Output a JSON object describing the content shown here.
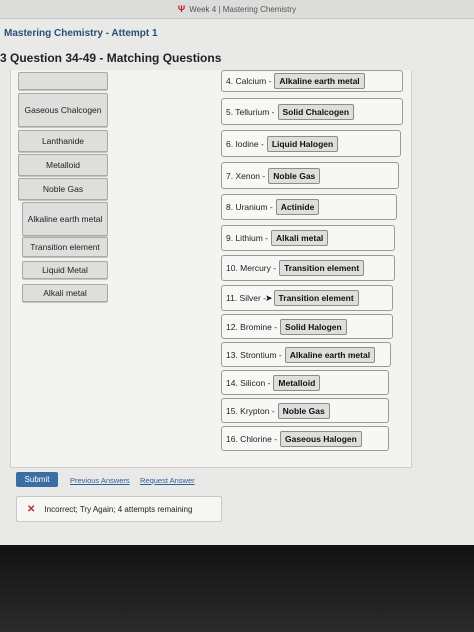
{
  "browser": {
    "tab_title": "Week 4 | Mastering Chemistry"
  },
  "header": {
    "attempt_title": "Mastering Chemistry - Attempt 1",
    "question_title": "3 Question 34-49 - Matching Questions"
  },
  "chips": [
    {
      "label": "Gaseous Chalcogen"
    },
    {
      "label": "Lanthanide"
    },
    {
      "label": "Metalloid"
    },
    {
      "label": "Noble Gas"
    },
    {
      "label": "Alkaline earth metal"
    },
    {
      "label": "Transition element"
    },
    {
      "label": "Liquid Metal"
    },
    {
      "label": "Alkali metal"
    }
  ],
  "rows": [
    {
      "label": "4. Calcium -",
      "answer": "Alkaline earth metal"
    },
    {
      "label": "5. Tellurium -",
      "answer": "Solid Chalcogen"
    },
    {
      "label": "6. Iodine -",
      "answer": "Liquid Halogen"
    },
    {
      "label": "7. Xenon -",
      "answer": "Noble Gas"
    },
    {
      "label": "8. Uranium -",
      "answer": "Actinide"
    },
    {
      "label": "9. Lithium -",
      "answer": "Alkali metal"
    },
    {
      "label": "10. Mercury -",
      "answer": "Transition element"
    },
    {
      "label": "11. Silver -",
      "answer": "Transition element"
    },
    {
      "label": "12. Bromine -",
      "answer": "Solid Halogen"
    },
    {
      "label": "13. Strontium -",
      "answer": "Alkaline earth metal"
    },
    {
      "label": "14. Silicon -",
      "answer": "Metalloid"
    },
    {
      "label": "15. Krypton -",
      "answer": "Noble Gas"
    },
    {
      "label": "16. Chlorine -",
      "answer": "Gaseous Halogen"
    }
  ],
  "actions": {
    "submit": "Submit",
    "previous_answers": "Previous Answers",
    "request_answer": "Request Answer"
  },
  "feedback": {
    "message": "Incorrect; Try Again; 4 attempts remaining"
  },
  "icons": {
    "tab": "shield-logo-icon",
    "error": "x-mark-icon",
    "cursor": "arrow-cursor-icon"
  }
}
